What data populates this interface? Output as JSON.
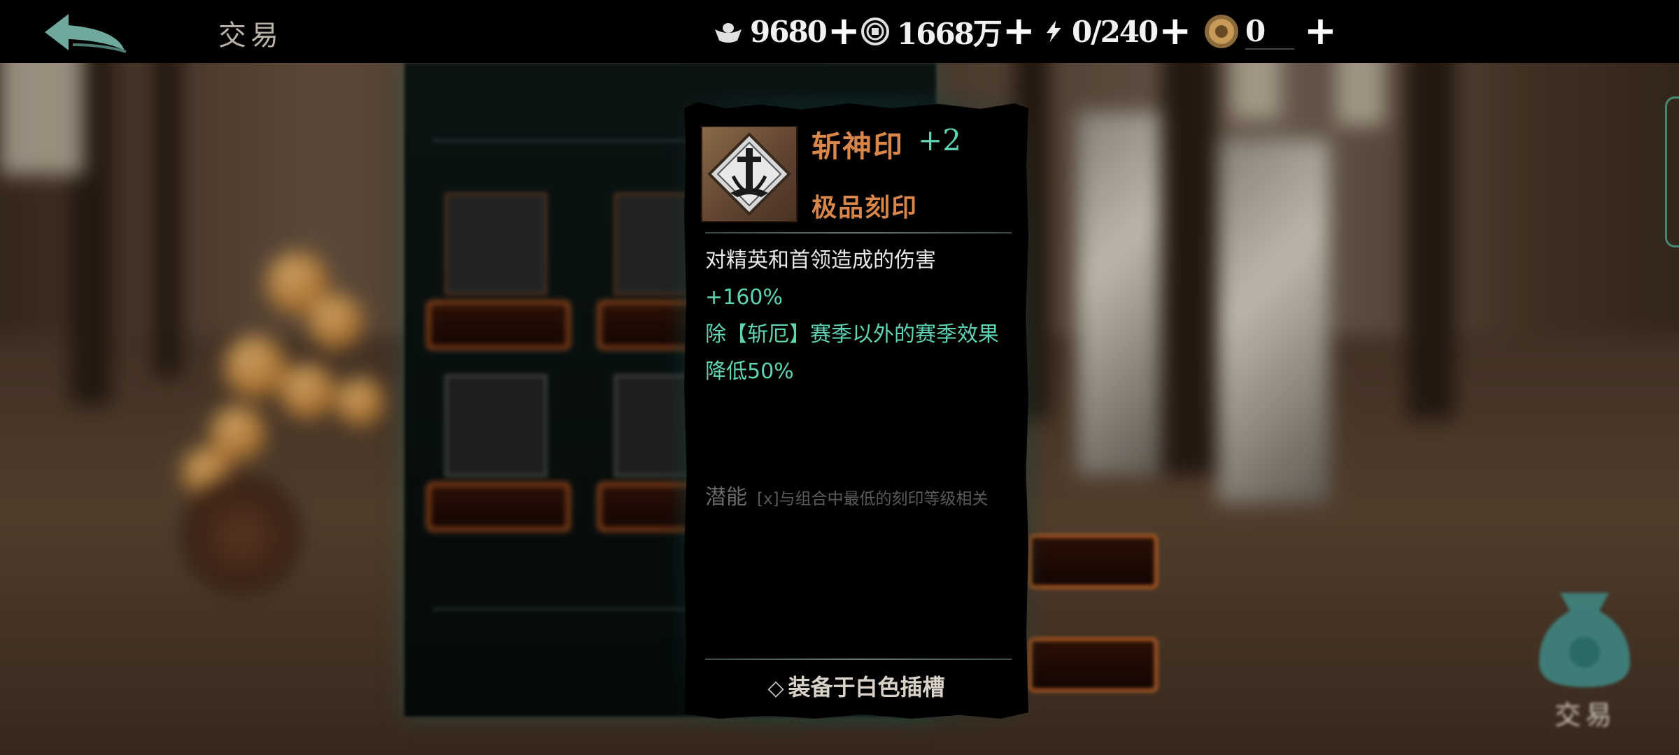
{
  "topbar": {
    "back_icon": "back-arrow-icon",
    "title": "交易",
    "resources": [
      {
        "icon": "silver-ingot-icon",
        "value": "9680",
        "plus": "+"
      },
      {
        "icon": "copper-coin-icon",
        "value": "1668万",
        "plus": "+"
      },
      {
        "icon": "lightning-energy-icon",
        "value": "0/240",
        "plus": "+"
      },
      {
        "icon": "gold-medallion-icon",
        "value": "0",
        "plus": "+"
      }
    ]
  },
  "tooltip": {
    "item_icon": "sword-seal-icon",
    "name": "斩神印",
    "level": "+2",
    "grade": "极品刻印",
    "desc_line1_prefix": "对精英和首领造成的伤害",
    "desc_line1_value": "+160%",
    "desc_line2": "除【斩厄】赛季以外的赛季效果降低50%",
    "potential_label": "潜能",
    "potential_note": "[x]与组合中最低的刻印等级相关",
    "equip_text": "装备于白色插槽",
    "equip_icon": "diamond-outline-icon"
  },
  "background": {
    "bag_label": "交易"
  },
  "colors": {
    "accent_orange": "#d9864a",
    "accent_green": "#5fd3b2",
    "panel_bg": "#000000"
  }
}
